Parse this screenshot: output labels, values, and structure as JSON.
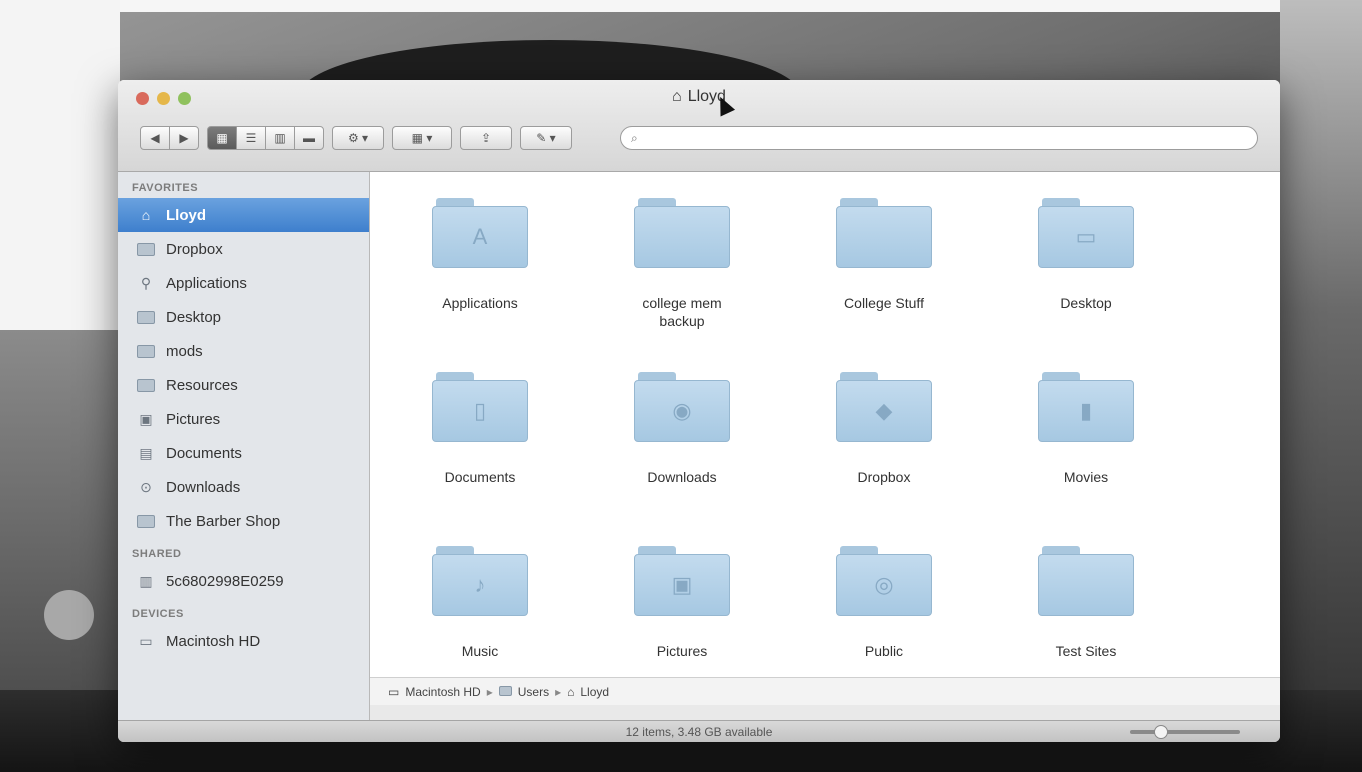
{
  "window": {
    "title": "Lloyd"
  },
  "toolbar": {
    "back": "◀",
    "forward": "▶",
    "view_icon": "▦",
    "view_list": "☰",
    "view_column": "▥",
    "view_coverflow": "▬",
    "action": "⚙ ▾",
    "arrange": "▦ ▾",
    "share": "⇪",
    "edit_tags": "✎ ▾",
    "search_icon": "🔍"
  },
  "sidebar": {
    "favorites_title": "FAVORITES",
    "favorites": [
      {
        "label": "Lloyd",
        "icon": "home-icon"
      },
      {
        "label": "Dropbox",
        "icon": "folder-icon"
      },
      {
        "label": "Applications",
        "icon": "applications-icon"
      },
      {
        "label": "Desktop",
        "icon": "folder-icon"
      },
      {
        "label": "mods",
        "icon": "folder-icon"
      },
      {
        "label": "Resources",
        "icon": "folder-icon"
      },
      {
        "label": "Pictures",
        "icon": "pictures-icon"
      },
      {
        "label": "Documents",
        "icon": "documents-icon"
      },
      {
        "label": "Downloads",
        "icon": "downloads-icon"
      },
      {
        "label": "The Barber Shop",
        "icon": "folder-icon"
      }
    ],
    "shared_title": "SHARED",
    "shared": [
      {
        "label": "5c6802998E0259",
        "icon": "server-icon"
      }
    ],
    "devices_title": "DEVICES",
    "devices": [
      {
        "label": "Macintosh HD",
        "icon": "disk-icon"
      }
    ]
  },
  "content": {
    "items": [
      {
        "label": "Applications",
        "glyph": "A"
      },
      {
        "label": "college mem backup",
        "glyph": ""
      },
      {
        "label": "College Stuff",
        "glyph": ""
      },
      {
        "label": "Desktop",
        "glyph": "▭"
      },
      {
        "label": "Documents",
        "glyph": "▯"
      },
      {
        "label": "Downloads",
        "glyph": "◉"
      },
      {
        "label": "Dropbox",
        "glyph": "◆"
      },
      {
        "label": "Movies",
        "glyph": "▮"
      },
      {
        "label": "Music",
        "glyph": "♪"
      },
      {
        "label": "Pictures",
        "glyph": "▣"
      },
      {
        "label": "Public",
        "glyph": "◎"
      },
      {
        "label": "Test Sites",
        "glyph": ""
      }
    ]
  },
  "pathbar": {
    "segments": [
      "Macintosh HD",
      "Users",
      "Lloyd"
    ],
    "separator": "▸"
  },
  "statusbar": {
    "text": "12 items, 3.48 GB available",
    "icon_size_level": 0.25
  }
}
